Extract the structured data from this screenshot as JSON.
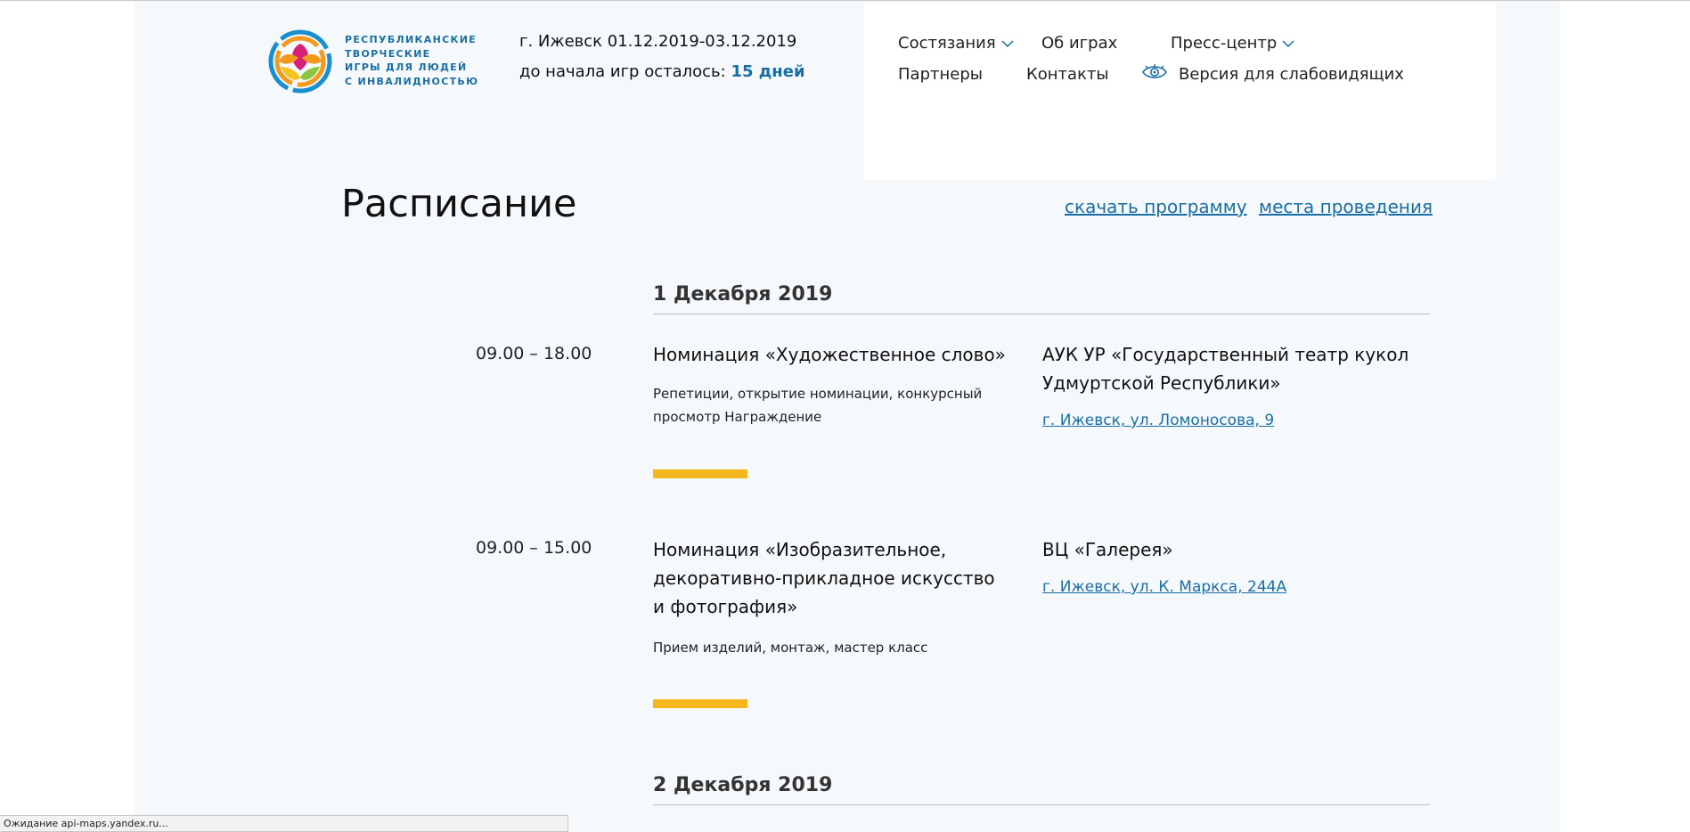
{
  "logo": {
    "lines": [
      "РЕСПУБЛИКАНСКИЕ",
      "ТВОРЧЕСКИЕ",
      "ИГРЫ ДЛЯ ЛЮДЕЙ",
      "С ИНВАЛИДНОСТЬЮ"
    ]
  },
  "event": {
    "city_dates": "г. Ижевск 01.12.2019-03.12.2019",
    "countdown_label": "до начала игр осталось:",
    "countdown_value": "15 дней"
  },
  "nav": {
    "competitions": "Состязания",
    "about": "Об играх",
    "press": "Пресс-центр",
    "partners": "Партнеры",
    "contacts": "Контакты",
    "accessibility": "Версия для слабовидящих"
  },
  "page": {
    "title": "Расписание",
    "download_link": "скачать программу",
    "venues_link": "места проведения"
  },
  "schedule": [
    {
      "date": "1 Декабря 2019",
      "events": [
        {
          "time": "09.00 – 18.00",
          "title": "Номинация «Художественное слово»",
          "description": "Репетиции, открытие номинации, конкурсный просмотр Награждение",
          "venue": "АУК УР «Государственный театр кукол Удмуртской Республики»",
          "address": "г. Ижевск, ул. Ломоносова, 9"
        },
        {
          "time": "09.00 – 15.00",
          "title": "Номинация «Изобразительное, декоративно-прикладное искусство и фотография»",
          "description": "Прием изделий, монтаж, мастер класс",
          "venue": "ВЦ «Галерея»",
          "address": "г. Ижевск, ул. К. Маркса, 244А"
        }
      ]
    },
    {
      "date": "2 Декабря 2019",
      "events": []
    }
  ],
  "statusbar": {
    "text": "Ожидание api-maps.yandex.ru..."
  },
  "colors": {
    "accent": "#1a6ea8",
    "highlight_bar": "#f4b71e",
    "page_bg": "#f6f9fc"
  }
}
